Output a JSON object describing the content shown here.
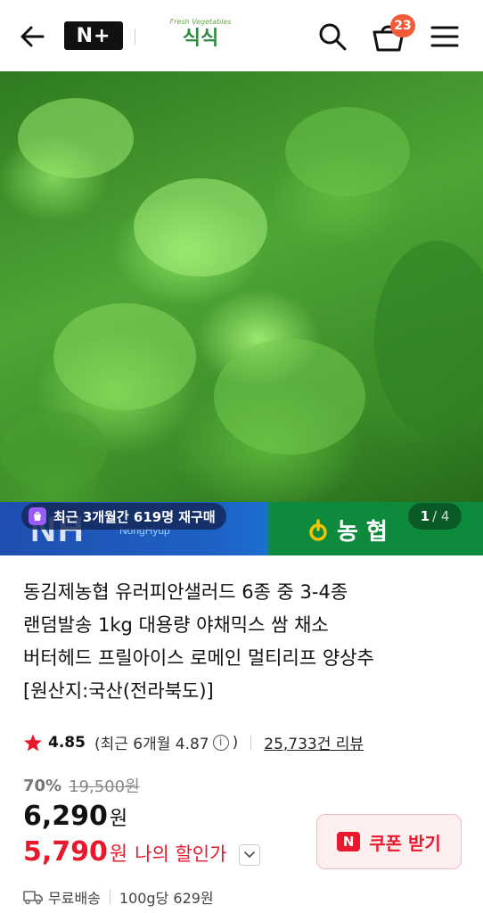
{
  "header": {
    "back_icon": "back-arrow-icon",
    "nplus_label": "N+",
    "brand_small": "Fresh Vegetables",
    "brand_name": "식식",
    "search_icon": "search-icon",
    "cart_icon": "cart-icon",
    "cart_count": "23",
    "menu_icon": "hamburger-menu-icon"
  },
  "hero": {
    "repurchase_badge": "최근 3개월간 619명 재구매",
    "banner_text": "NH",
    "banner_sub": "NongHyup",
    "brand_logo_text": "농 협",
    "image_index": "1",
    "image_total": "/ 4"
  },
  "product": {
    "title_lines": [
      "동김제농협 유러피안샐러드 6종 중 3-4종",
      "랜덤발송 1kg 대용량 야채믹스 쌈 채소",
      "버터헤드 프릴아이스 로메인 멀티리프 양상추",
      "[원산지:국산(전라북도)]"
    ],
    "rating_score": "4.85",
    "rating_recent_prefix": "(최근 6개월 4.87",
    "rating_recent_suffix": ")",
    "review_count": "25,733건 리뷰",
    "discount_pct": "70%",
    "original_price": "19,500원",
    "price": "6,290",
    "price_unit": "원",
    "my_price": "5,790",
    "my_price_unit": "원",
    "my_price_label": "나의 할인가",
    "coupon_logo": "N",
    "coupon_label": "쿠폰 받기",
    "shipping_label": "무료배송",
    "unit_price": "100g당 629원"
  },
  "colors": {
    "accent_red": "#e8192c",
    "badge_orange": "#f25a3a",
    "brand_green": "#2f8a3f"
  }
}
